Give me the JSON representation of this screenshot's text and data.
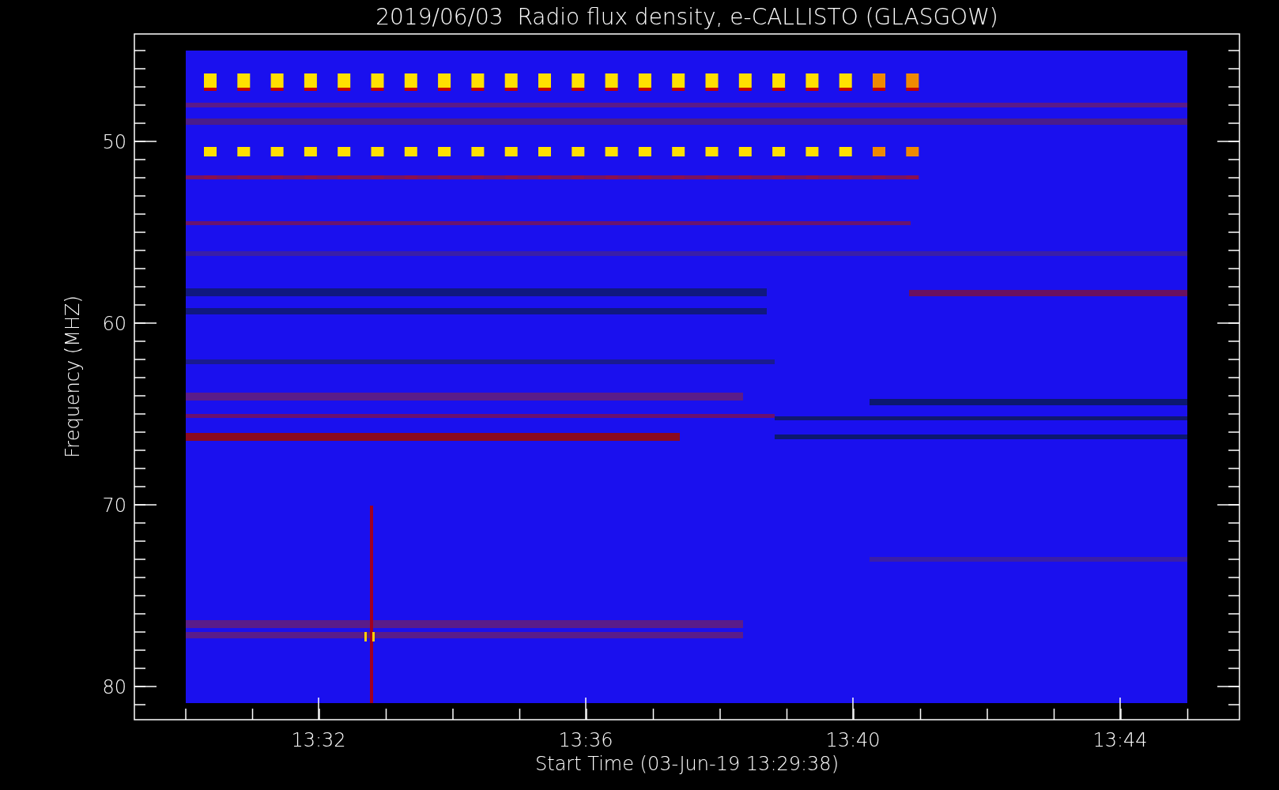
{
  "title": "2019/06/03  Radio flux density, e-CALLISTO (GLASGOW)",
  "y_axis": {
    "label": "Frequency (MHZ)",
    "ticks": [
      "50",
      "60",
      "70",
      "80"
    ]
  },
  "x_axis": {
    "label": "Start Time (03-Jun-19 13:29:38)",
    "ticks": [
      "13:32",
      "13:36",
      "13:40",
      "13:44"
    ]
  }
}
